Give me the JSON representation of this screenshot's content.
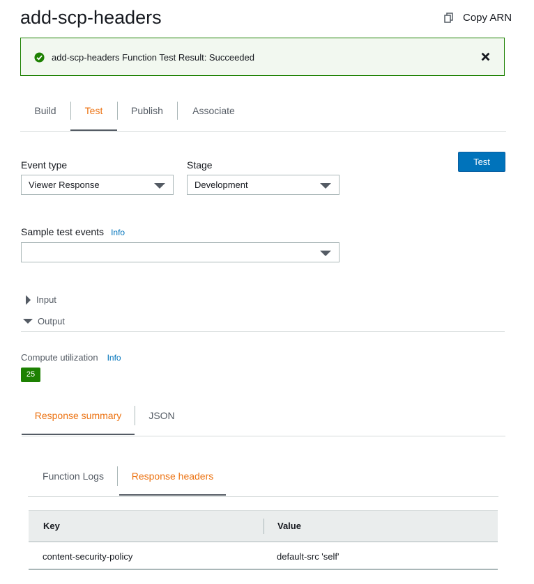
{
  "header": {
    "title": "add-scp-headers",
    "copy_arn_label": "Copy ARN",
    "copy_icon": "copy-icon"
  },
  "flash": {
    "status": "success",
    "message": "add-scp-headers Function Test Result: Succeeded",
    "icon": "check-circle-icon",
    "close_icon": "close-icon",
    "color": "#1d8102"
  },
  "main_tabs": [
    {
      "label": "Build",
      "active": false
    },
    {
      "label": "Test",
      "active": true
    },
    {
      "label": "Publish",
      "active": false
    },
    {
      "label": "Associate",
      "active": false
    }
  ],
  "form": {
    "event_type": {
      "label": "Event type",
      "value": "Viewer Response"
    },
    "stage": {
      "label": "Stage",
      "value": "Development"
    },
    "sample_events": {
      "label": "Sample test events",
      "info": "Info",
      "value": ""
    },
    "test_button": "Test"
  },
  "sections": {
    "input": {
      "label": "Input",
      "expanded": false
    },
    "output": {
      "label": "Output",
      "expanded": true
    }
  },
  "compute": {
    "label": "Compute utilization",
    "info": "Info",
    "value": "25"
  },
  "result_tabs": [
    {
      "label": "Response summary",
      "active": true
    },
    {
      "label": "JSON",
      "active": false
    }
  ],
  "summary_tabs": [
    {
      "label": "Function Logs",
      "active": false
    },
    {
      "label": "Response headers",
      "active": true
    }
  ],
  "headers_table": {
    "columns": [
      "Key",
      "Value"
    ],
    "rows": [
      {
        "key": "content-security-policy",
        "value": "default-src 'self'"
      }
    ]
  },
  "colors": {
    "accent": "#ec7211",
    "primary_button": "#0073bb",
    "success": "#1d8102",
    "link": "#0073bb"
  }
}
